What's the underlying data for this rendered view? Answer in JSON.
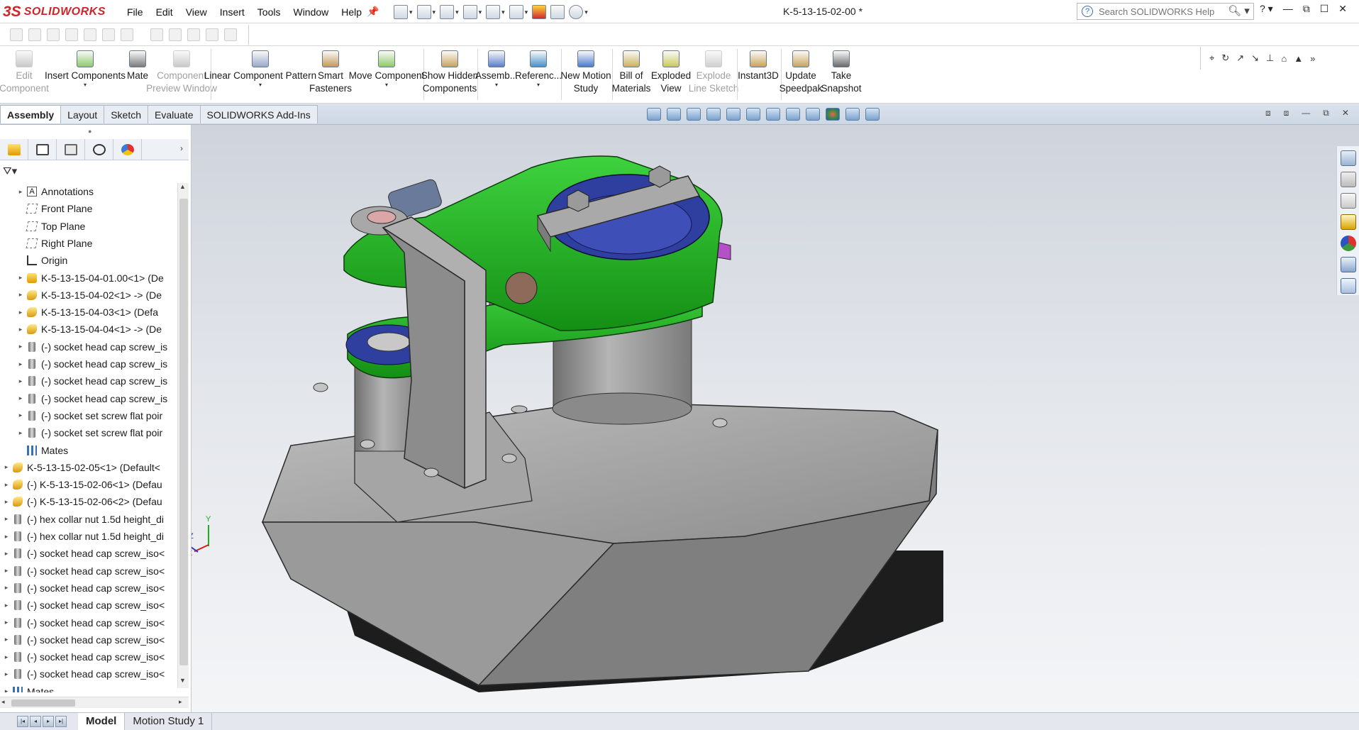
{
  "app": {
    "brand": "SOLIDWORKS",
    "doc_title": "K-5-13-15-02-00 *"
  },
  "menu": [
    "File",
    "Edit",
    "View",
    "Insert",
    "Tools",
    "Window",
    "Help"
  ],
  "search": {
    "placeholder": "Search SOLIDWORKS Help"
  },
  "command_manager": [
    {
      "label": "Edit\nComponent",
      "enabled": false,
      "icon": "edit-component-icon"
    },
    {
      "label": "Insert Components",
      "enabled": true,
      "icon": "insert-components-icon",
      "dropdown": true
    },
    {
      "label": "Mate",
      "enabled": true,
      "icon": "mate-icon"
    },
    {
      "label": "Component\nPreview Window",
      "enabled": false,
      "icon": "component-preview-icon"
    },
    {
      "label": "Linear Component Pattern",
      "enabled": true,
      "icon": "linear-pattern-icon",
      "dropdown": true
    },
    {
      "label": "Smart\nFasteners",
      "enabled": true,
      "icon": "smart-fasteners-icon"
    },
    {
      "label": "Move Component",
      "enabled": true,
      "icon": "move-component-icon",
      "dropdown": true
    },
    {
      "label": "Show Hidden\nComponents",
      "enabled": true,
      "icon": "show-hidden-icon"
    },
    {
      "label": "Assemb...",
      "enabled": true,
      "icon": "assembly-features-icon",
      "dropdown": true
    },
    {
      "label": "Referenc...",
      "enabled": true,
      "icon": "reference-geometry-icon",
      "dropdown": true
    },
    {
      "label": "New Motion\nStudy",
      "enabled": true,
      "icon": "motion-study-icon"
    },
    {
      "label": "Bill of\nMaterials",
      "enabled": true,
      "icon": "bom-icon"
    },
    {
      "label": "Exploded\nView",
      "enabled": true,
      "icon": "exploded-view-icon"
    },
    {
      "label": "Explode\nLine Sketch",
      "enabled": false,
      "icon": "explode-line-icon"
    },
    {
      "label": "Instant3D",
      "enabled": true,
      "icon": "instant3d-icon"
    },
    {
      "label": "Update\nSpeedpak",
      "enabled": true,
      "icon": "speedpak-icon"
    },
    {
      "label": "Take\nSnapshot",
      "enabled": true,
      "icon": "camera-icon"
    }
  ],
  "command_tabs": [
    "Assembly",
    "Layout",
    "Sketch",
    "Evaluate",
    "SOLIDWORKS Add-Ins"
  ],
  "active_command_tab": "Assembly",
  "tree": [
    {
      "label": "Annotations",
      "icon": "annotations",
      "level": 1,
      "expand": true
    },
    {
      "label": "Front Plane",
      "icon": "plane",
      "level": 1,
      "expand": false
    },
    {
      "label": "Top Plane",
      "icon": "plane",
      "level": 1,
      "expand": false
    },
    {
      "label": "Right Plane",
      "icon": "plane",
      "level": 1,
      "expand": false
    },
    {
      "label": "Origin",
      "icon": "origin",
      "level": 1,
      "expand": false
    },
    {
      "label": "K-5-13-15-04-01.00<1> (De",
      "icon": "subassembly",
      "level": 1,
      "expand": true
    },
    {
      "label": "K-5-13-15-04-02<1> -> (De",
      "icon": "part",
      "level": 1,
      "expand": true
    },
    {
      "label": "K-5-13-15-04-03<1> (Defa",
      "icon": "part",
      "level": 1,
      "expand": true
    },
    {
      "label": "K-5-13-15-04-04<1> -> (De",
      "icon": "part",
      "level": 1,
      "expand": true
    },
    {
      "label": "(-) socket head cap screw_is",
      "icon": "screw",
      "level": 1,
      "expand": true
    },
    {
      "label": "(-) socket head cap screw_is",
      "icon": "screw",
      "level": 1,
      "expand": true
    },
    {
      "label": "(-) socket head cap screw_is",
      "icon": "screw",
      "level": 1,
      "expand": true
    },
    {
      "label": "(-) socket head cap screw_is",
      "icon": "screw",
      "level": 1,
      "expand": true
    },
    {
      "label": "(-) socket set screw flat poir",
      "icon": "screw",
      "level": 1,
      "expand": true
    },
    {
      "label": "(-) socket set screw flat poir",
      "icon": "screw",
      "level": 1,
      "expand": true
    },
    {
      "label": "Mates",
      "icon": "mates",
      "level": 1,
      "expand": false
    },
    {
      "label": "K-5-13-15-02-05<1> (Default<",
      "icon": "part",
      "level": 0,
      "expand": true
    },
    {
      "label": "(-) K-5-13-15-02-06<1> (Defau",
      "icon": "part",
      "level": 0,
      "expand": true
    },
    {
      "label": "(-) K-5-13-15-02-06<2> (Defau",
      "icon": "part",
      "level": 0,
      "expand": true
    },
    {
      "label": "(-) hex collar nut 1.5d height_di",
      "icon": "screw",
      "level": 0,
      "expand": true
    },
    {
      "label": "(-) hex collar nut 1.5d height_di",
      "icon": "screw",
      "level": 0,
      "expand": true
    },
    {
      "label": "(-) socket head cap screw_iso<",
      "icon": "screw",
      "level": 0,
      "expand": true
    },
    {
      "label": "(-) socket head cap screw_iso<",
      "icon": "screw",
      "level": 0,
      "expand": true
    },
    {
      "label": "(-) socket head cap screw_iso<",
      "icon": "screw",
      "level": 0,
      "expand": true
    },
    {
      "label": "(-) socket head cap screw_iso<",
      "icon": "screw",
      "level": 0,
      "expand": true
    },
    {
      "label": "(-) socket head cap screw_iso<",
      "icon": "screw",
      "level": 0,
      "expand": true
    },
    {
      "label": "(-) socket head cap screw_iso<",
      "icon": "screw",
      "level": 0,
      "expand": true
    },
    {
      "label": "(-) socket head cap screw_iso<",
      "icon": "screw",
      "level": 0,
      "expand": true
    },
    {
      "label": "(-) socket head cap screw_iso<",
      "icon": "screw",
      "level": 0,
      "expand": true
    },
    {
      "label": "Mates",
      "icon": "mates",
      "level": 0,
      "expand": true
    }
  ],
  "bottom_tabs": [
    "Model",
    "Motion Study 1"
  ],
  "active_bottom_tab": "Model",
  "triad": {
    "x": "X",
    "y": "Y",
    "z": "Z"
  },
  "colors": {
    "green": "#1fae1f",
    "blue": "#2e3fa0",
    "magenta": "#b451c9",
    "gray": "#9c9c9c",
    "dark": "#2a2a2a",
    "sw_red": "#d2232a"
  }
}
